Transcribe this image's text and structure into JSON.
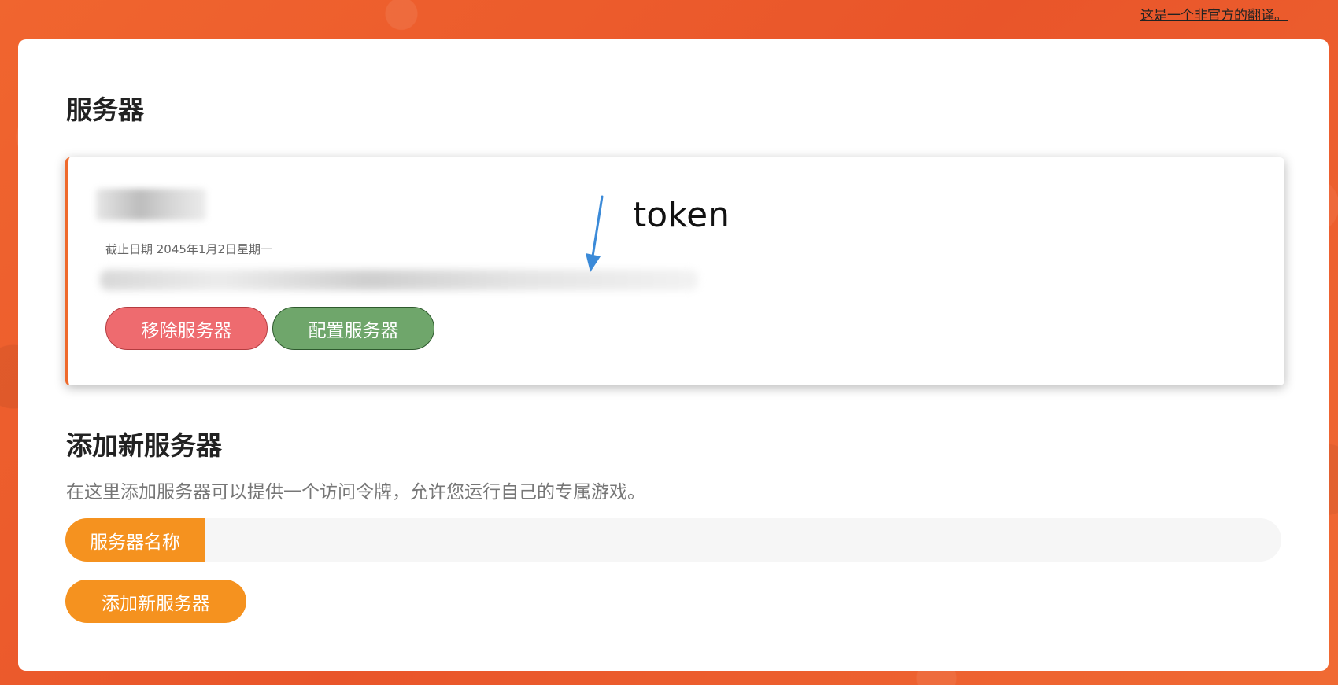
{
  "header": {
    "translation_note": "这是一个非官方的翻译。"
  },
  "servers_section": {
    "title": "服务器",
    "server": {
      "deadline": "截止日期 2045年1月2日星期一",
      "annotation": "token",
      "remove_label": "移除服务器",
      "configure_label": "配置服务器"
    }
  },
  "add_section": {
    "title": "添加新服务器",
    "description": "在这里添加服务器可以提供一个访问令牌，允许您运行自己的专属游戏。",
    "name_label": "服务器名称",
    "name_value": "",
    "add_label": "添加新服务器"
  },
  "colors": {
    "background": "#ec5a2c",
    "accent": "#f5921f",
    "remove": "#ee6b6f",
    "configure": "#6fa66b"
  }
}
